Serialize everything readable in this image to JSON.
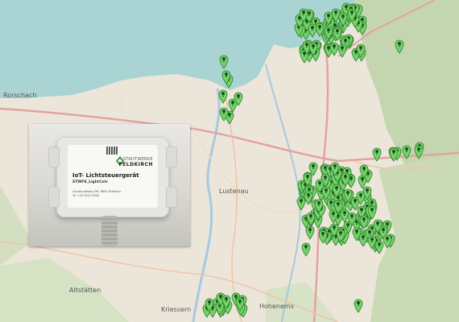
{
  "map": {
    "colors": {
      "lake": "#a9d4d3",
      "land": "#ece6da",
      "forest": "#c4d6b0",
      "road": "#e3a3a0",
      "river": "#a8c9dd",
      "marker": "#74d46b",
      "marker_stroke": "#2f7d2c"
    },
    "places": {
      "rorschach": "Rorschach",
      "lustenau": "Lustenau",
      "altstatten": "Altstätten",
      "hohenems": "Hohenems",
      "kriessern": "Kriessern"
    },
    "marker_icon": "map-pin-light-icon"
  },
  "photo": {
    "brand_line1": "STADTWERKE",
    "brand_line2": "FELDKIRCH",
    "device_title": "IoT- Lichtsteuergerät",
    "device_code": "STWFK_LightCntr",
    "address": "Leusbündtweg 49C 6800 Feldkirch",
    "phone": "Tel +43 5522 9000"
  }
}
